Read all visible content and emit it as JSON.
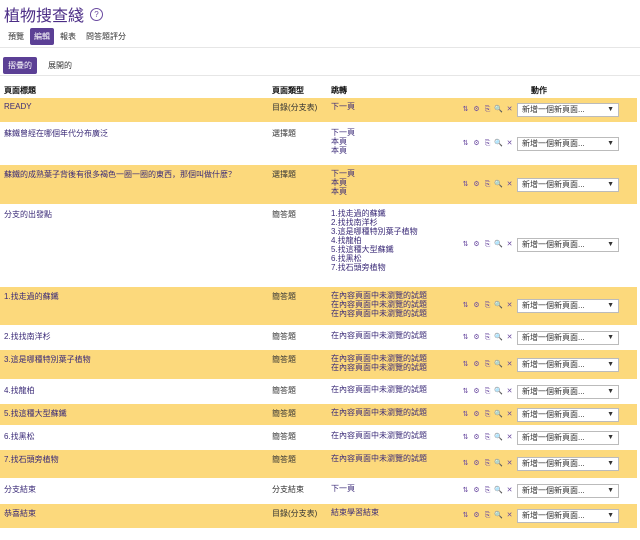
{
  "page_title": "植物搜查綫",
  "help_icon": "?",
  "tabs": [
    "預覽",
    "編輯",
    "報表",
    "問答題評分"
  ],
  "active_tab": 1,
  "subtabs": [
    "摺疊的",
    "展開的"
  ],
  "active_subtab": 0,
  "columns": {
    "title": "頁面標題",
    "type": "頁面類型",
    "jump": "跳轉",
    "action": "動作"
  },
  "select_placeholder": "新增一個新頁面...",
  "rows": [
    {
      "title": "READY",
      "type": "目錄(分支表)",
      "jump": [
        "下一頁"
      ]
    },
    {
      "title": "蘇鐵曾經在哪個年代分布廣泛",
      "type": "選擇題",
      "jump": [
        "下一頁",
        "本頁",
        "本頁"
      ]
    },
    {
      "title": "蘇鐵的成熟葉子背後有很多褐色一圈一圈的東西，那個叫做什麼？",
      "type": "選擇題",
      "jump": [
        "下一頁",
        "本頁",
        "本頁"
      ]
    },
    {
      "title": "分支的出發點",
      "type": "簡答題",
      "jump": [
        "1.找走過的蘇鐵",
        "2.找找南洋杉",
        "3.這是哪種特別葉子植物",
        "4.找龍柏",
        "5.找這種大型蘇鐵",
        "6.找黑松",
        "7.找石頭旁植物"
      ]
    },
    {
      "title": "1.找走過的蘇鐵",
      "type": "簡答題",
      "jump": [
        "在內容頁面中未瀏覽的試題",
        "在內容頁面中未瀏覽的試題",
        "在內容頁面中未瀏覽的試題"
      ]
    },
    {
      "title": "2.找找南洋杉",
      "type": "簡答題",
      "jump": [
        "在內容頁面中未瀏覽的試題"
      ]
    },
    {
      "title": "3.這是哪種特別葉子植物",
      "type": "簡答題",
      "jump": [
        "在內容頁面中未瀏覽的試題",
        "在內容頁面中未瀏覽的試題"
      ]
    },
    {
      "title": "4.找龍柏",
      "type": "簡答題",
      "jump": [
        "在內容頁面中未瀏覽的試題"
      ]
    },
    {
      "title": "5.找這種大型蘇鐵",
      "type": "簡答題",
      "jump": [
        "在內容頁面中未瀏覽的試題"
      ]
    },
    {
      "title": "6.找黑松",
      "type": "簡答題",
      "jump": [
        "在內容頁面中未瀏覽的試題"
      ]
    },
    {
      "title": "7.找石頭旁植物",
      "type": "簡答題",
      "jump": [
        "在內容頁面中未瀏覽的試題"
      ]
    },
    {
      "title": "分支結束",
      "type": "分支結束",
      "jump": [
        "下一頁"
      ]
    },
    {
      "title": "恭喜結束",
      "type": "目錄(分支表)",
      "jump": [
        "結束學習結束"
      ]
    }
  ],
  "row_actions": [
    {
      "name": "move-icon",
      "glyph": "⇅"
    },
    {
      "name": "settings-icon",
      "glyph": "⚙"
    },
    {
      "name": "copy-icon",
      "glyph": "⎘"
    },
    {
      "name": "preview-icon",
      "glyph": "🔍"
    },
    {
      "name": "delete-icon",
      "glyph": "✕"
    }
  ],
  "colors": {
    "accent": "#5b3f95",
    "alt_row": "#fcd97c",
    "title": "#4b2d86"
  }
}
